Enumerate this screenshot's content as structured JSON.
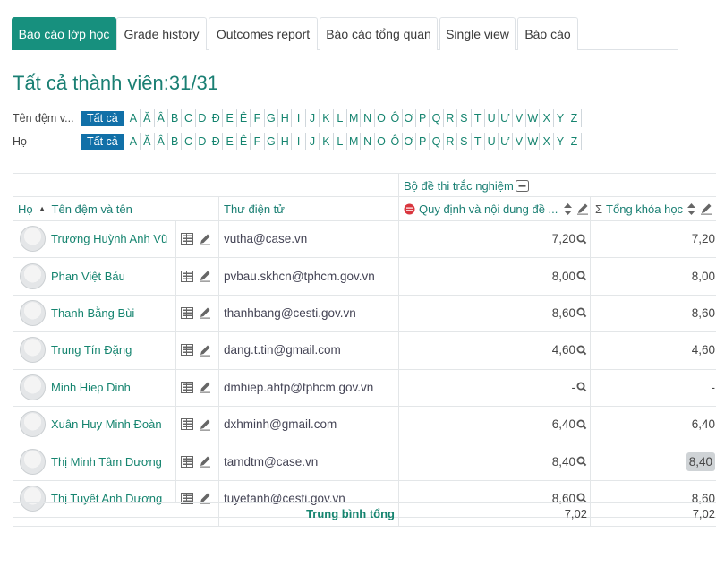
{
  "tabs": [
    {
      "label": "Báo cáo lớp học",
      "active": true
    },
    {
      "label": "Grade history",
      "active": false
    },
    {
      "label": "Outcomes report",
      "active": false
    },
    {
      "label": "Báo cáo tổng quan",
      "active": false
    },
    {
      "label": "Single view",
      "active": false
    },
    {
      "label": "Báo cáo",
      "active": false
    }
  ],
  "page_title": "Tất cả thành viên:31/31",
  "initials_bars": [
    {
      "label": "Tên đệm v...",
      "all_label": "Tất cả"
    },
    {
      "label": "Họ",
      "all_label": "Tất cả"
    }
  ],
  "letters": [
    "A",
    "Ă",
    "Â",
    "B",
    "C",
    "D",
    "Đ",
    "E",
    "Ê",
    "F",
    "G",
    "H",
    "I",
    "J",
    "K",
    "L",
    "M",
    "N",
    "O",
    "Ô",
    "Ơ",
    "P",
    "Q",
    "R",
    "S",
    "T",
    "U",
    "Ư",
    "V",
    "W",
    "X",
    "Y",
    "Z"
  ],
  "table": {
    "category_header": "Bộ đề thi trắc nghiệm",
    "col_name_header": "Họ",
    "col_name_header_sep": "/",
    "col_name_header_2": "Tên đệm và tên",
    "col_email_header": "Thư điện tử",
    "col_quiz_header": "Quy định và nội dung đề ...",
    "col_total_header": "Tổng khóa học",
    "rows": [
      {
        "name": "Trương Huỳnh Anh Vũ",
        "email": "vutha@case.vn",
        "quiz": "7,20",
        "total": "7,20"
      },
      {
        "name": "Phan Việt Báu",
        "email": "pvbau.skhcn@tphcm.gov.vn",
        "quiz": "8,00",
        "total": "8,00"
      },
      {
        "name": "Thanh Bằng Bùi",
        "email": "thanhbang@cesti.gov.vn",
        "quiz": "8,60",
        "total": "8,60"
      },
      {
        "name": "Trung Tín Đặng",
        "email": "dang.t.tin@gmail.com",
        "quiz": "4,60",
        "total": "4,60"
      },
      {
        "name": "Minh Hiep Dinh",
        "email": "dmhiep.ahtp@tphcm.gov.vn",
        "quiz": "-",
        "total": "-"
      },
      {
        "name": "Xuân Huy Minh Đoàn",
        "email": "dxhminh@gmail.com",
        "quiz": "6,40",
        "total": "6,40"
      },
      {
        "name": "Thị Minh Tâm Dương",
        "email": "tamdtm@case.vn",
        "quiz": "8,40",
        "total": "8,40"
      },
      {
        "name": "Thị Tuyết Anh Dương",
        "email": "tuyetanh@cesti.gov.vn",
        "quiz": "8,60",
        "total": "8,60"
      }
    ],
    "average_label": "Trung bình tổng",
    "average_quiz": "7,02",
    "average_total": "7,02"
  },
  "colors": {
    "accent": "#17907e",
    "link": "#15846f",
    "all_button": "#1170a8",
    "quiz_icon": "#d9363e"
  }
}
